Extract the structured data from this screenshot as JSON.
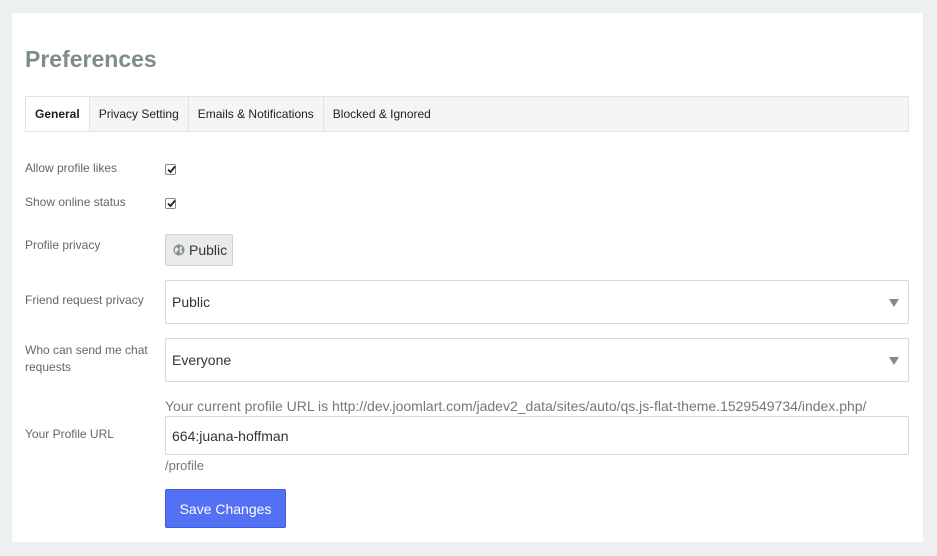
{
  "page": {
    "title": "Preferences"
  },
  "tabs": [
    {
      "label": "General",
      "active": true
    },
    {
      "label": "Privacy Setting",
      "active": false
    },
    {
      "label": "Emails & Notifications",
      "active": false
    },
    {
      "label": "Blocked & Ignored",
      "active": false
    }
  ],
  "form": {
    "allow_likes": {
      "label": "Allow profile likes",
      "checked": true
    },
    "online_status": {
      "label": "Show online status",
      "checked": true
    },
    "profile_privacy": {
      "label": "Profile privacy",
      "value": "Public",
      "icon": "globe-icon"
    },
    "friend_request": {
      "label": "Friend request privacy",
      "value": "Public"
    },
    "chat_requests": {
      "label": "Who can send me chat requests",
      "value": "Everyone"
    },
    "profile_url": {
      "label": "Your Profile URL",
      "hint": "Your current profile URL is http://dev.joomlart.com/jadev2_data/sites/auto/qs.js-flat-theme.1529549734/index.php/",
      "value": "664:juana-hoffman",
      "suffix": "/profile"
    },
    "save_label": "Save Changes"
  },
  "colors": {
    "accent": "#5470f4",
    "title": "#7e8c8d",
    "background": "#edf0f1"
  }
}
